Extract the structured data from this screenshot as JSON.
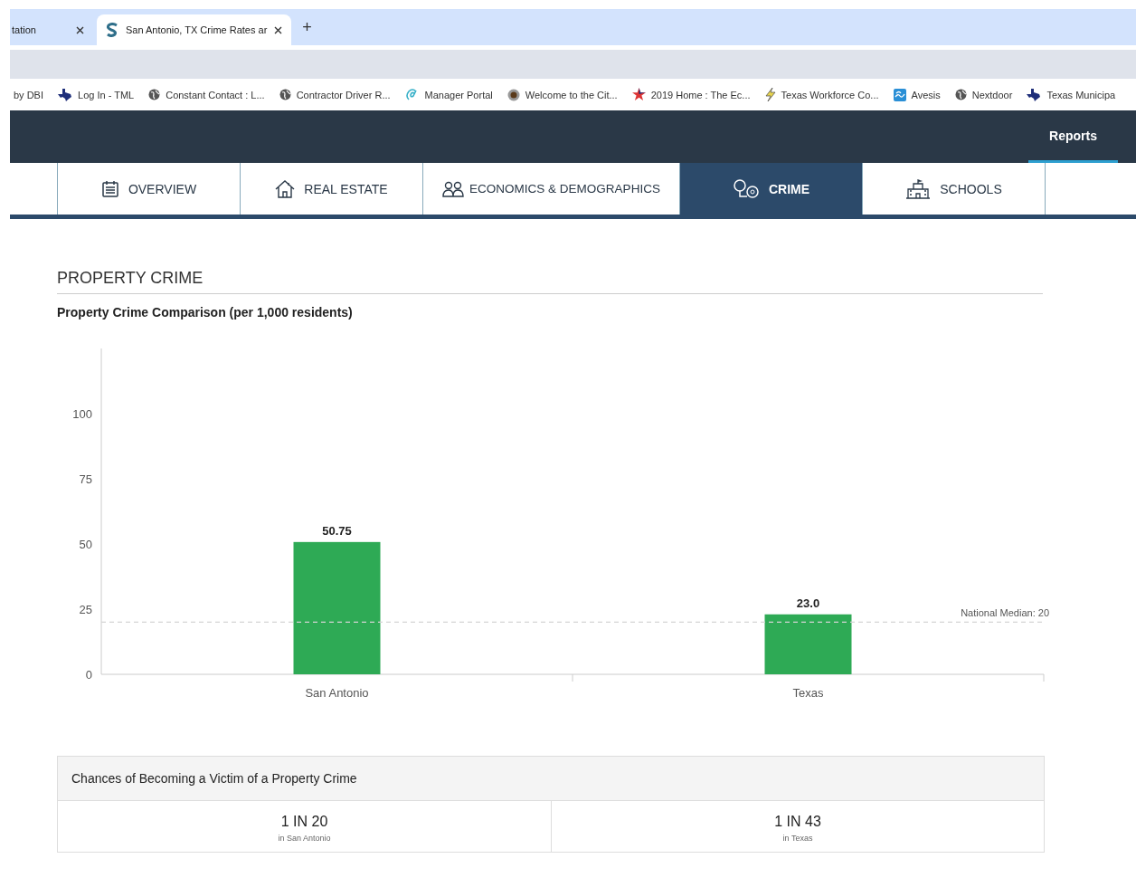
{
  "browser_tabs": [
    {
      "title": "tation",
      "selected": false,
      "kind": "plain"
    },
    {
      "title": "San Antonio, TX Crime Rates ar",
      "selected": true,
      "kind": "site"
    }
  ],
  "new_tab": "+",
  "bookmarks": [
    {
      "label": "by DBI",
      "kind": "none"
    },
    {
      "label": "Log In - TML",
      "kind": "texas"
    },
    {
      "label": "Constant Contact : L...",
      "kind": "globe"
    },
    {
      "label": "Contractor Driver R...",
      "kind": "globe"
    },
    {
      "label": "Manager Portal",
      "kind": "at"
    },
    {
      "label": "Welcome to the Cit...",
      "kind": "seal"
    },
    {
      "label": "2019 Home : The Ec...",
      "kind": "star"
    },
    {
      "label": "Texas Workforce Co...",
      "kind": "bolt"
    },
    {
      "label": "Avesis",
      "kind": "avesis"
    },
    {
      "label": "Nextdoor",
      "kind": "globe"
    },
    {
      "label": "Texas Municipa",
      "kind": "texas"
    }
  ],
  "top_nav": [
    {
      "label": "Reports",
      "selected": true
    }
  ],
  "tabs": [
    {
      "label": "OVERVIEW",
      "kind": "overview",
      "selected": false
    },
    {
      "label": "REAL ESTATE",
      "kind": "house",
      "selected": false
    },
    {
      "label": "ECONOMICS & DEMOGRAPHICS",
      "kind": "people",
      "selected": false
    },
    {
      "label": "CRIME",
      "kind": "crime",
      "selected": true
    },
    {
      "label": "SCHOOLS",
      "kind": "school",
      "selected": false
    }
  ],
  "section": {
    "title": "PROPERTY CRIME",
    "subtitle": "Property Crime Comparison (per 1,000 residents)",
    "chart_data": {
      "type": "bar",
      "categories": [
        "San Antonio",
        "Texas"
      ],
      "values": [
        50.75,
        23.0
      ],
      "ylim": [
        0,
        125
      ],
      "yticks": [
        0,
        25,
        50,
        75,
        100
      ],
      "value_labels": [
        "50.75",
        "23.0"
      ],
      "ref_lines": [
        {
          "axis": "y",
          "value": 20,
          "label": "National Median: 20"
        }
      ]
    }
  },
  "chances": {
    "title": "Chances of Becoming a Victim of a Property Crime",
    "items": [
      {
        "value": "1 IN 20",
        "place": "in San Antonio"
      },
      {
        "value": "1 IN 43",
        "place": "in Texas"
      }
    ]
  }
}
